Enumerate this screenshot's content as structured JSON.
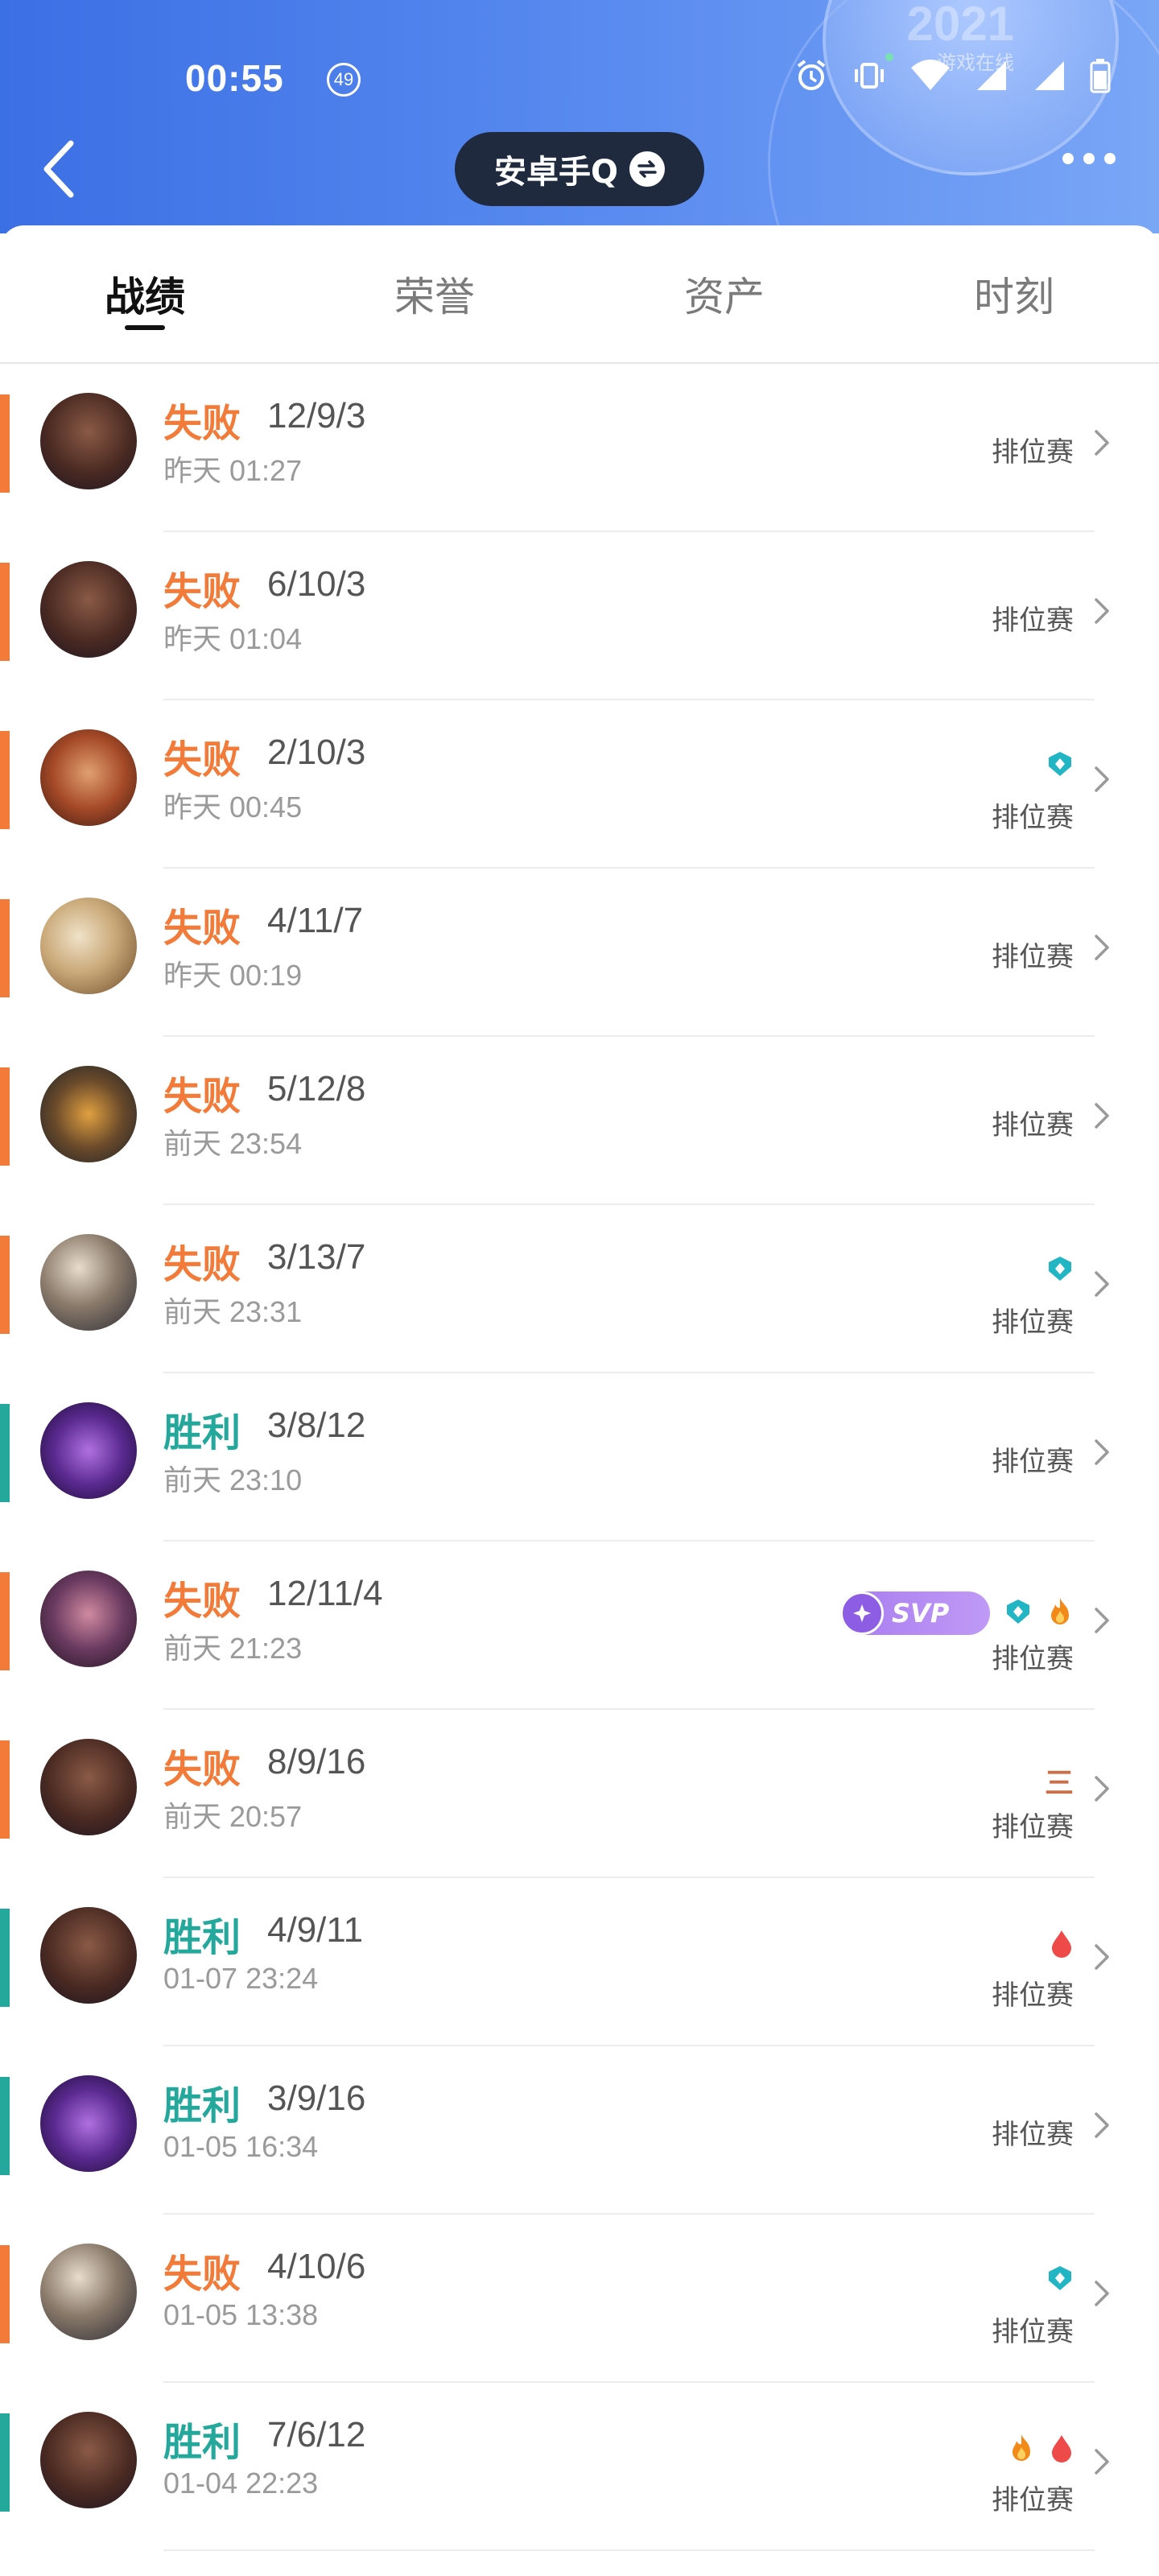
{
  "status": {
    "time": "00:55",
    "badge": "49"
  },
  "header": {
    "account": "安卓手Q",
    "deco_year": "2021",
    "deco_text": "游戏在线"
  },
  "tabs": [
    {
      "label": "战绩",
      "active": true
    },
    {
      "label": "荣誉",
      "active": false
    },
    {
      "label": "资产",
      "active": false
    },
    {
      "label": "时刻",
      "active": false
    }
  ],
  "colors": {
    "lose": "#f27b3a",
    "win": "#25a89c",
    "header": "#3b6fe4"
  },
  "matches": [
    {
      "result": "失败",
      "kda": "12/9/3",
      "time": "昨天 01:27",
      "mode": "排位赛",
      "badges": []
    },
    {
      "result": "失败",
      "kda": "6/10/3",
      "time": "昨天 01:04",
      "mode": "排位赛",
      "badges": []
    },
    {
      "result": "失败",
      "kda": "2/10/3",
      "time": "昨天 00:45",
      "mode": "排位赛",
      "badges": [
        "shield"
      ]
    },
    {
      "result": "失败",
      "kda": "4/11/7",
      "time": "昨天 00:19",
      "mode": "排位赛",
      "badges": []
    },
    {
      "result": "失败",
      "kda": "5/12/8",
      "time": "前天 23:54",
      "mode": "排位赛",
      "badges": []
    },
    {
      "result": "失败",
      "kda": "3/13/7",
      "time": "前天 23:31",
      "mode": "排位赛",
      "badges": [
        "shield"
      ]
    },
    {
      "result": "胜利",
      "kda": "3/8/12",
      "time": "前天 23:10",
      "mode": "排位赛",
      "badges": []
    },
    {
      "result": "失败",
      "kda": "12/11/4",
      "time": "前天 21:23",
      "mode": "排位赛",
      "badges": [
        "svp",
        "shield",
        "fire"
      ],
      "svp_label": "SVP"
    },
    {
      "result": "失败",
      "kda": "8/9/16",
      "time": "前天 20:57",
      "mode": "排位赛",
      "badges": [
        "triple"
      ],
      "triple_label": "三"
    },
    {
      "result": "胜利",
      "kda": "4/9/11",
      "time": "01-07 23:24",
      "mode": "排位赛",
      "badges": [
        "blood"
      ]
    },
    {
      "result": "胜利",
      "kda": "3/9/16",
      "time": "01-05 16:34",
      "mode": "排位赛",
      "badges": []
    },
    {
      "result": "失败",
      "kda": "4/10/6",
      "time": "01-05 13:38",
      "mode": "排位赛",
      "badges": [
        "shield"
      ]
    },
    {
      "result": "胜利",
      "kda": "7/6/12",
      "time": "01-04 22:23",
      "mode": "排位赛",
      "badges": [
        "fire",
        "blood"
      ]
    }
  ]
}
